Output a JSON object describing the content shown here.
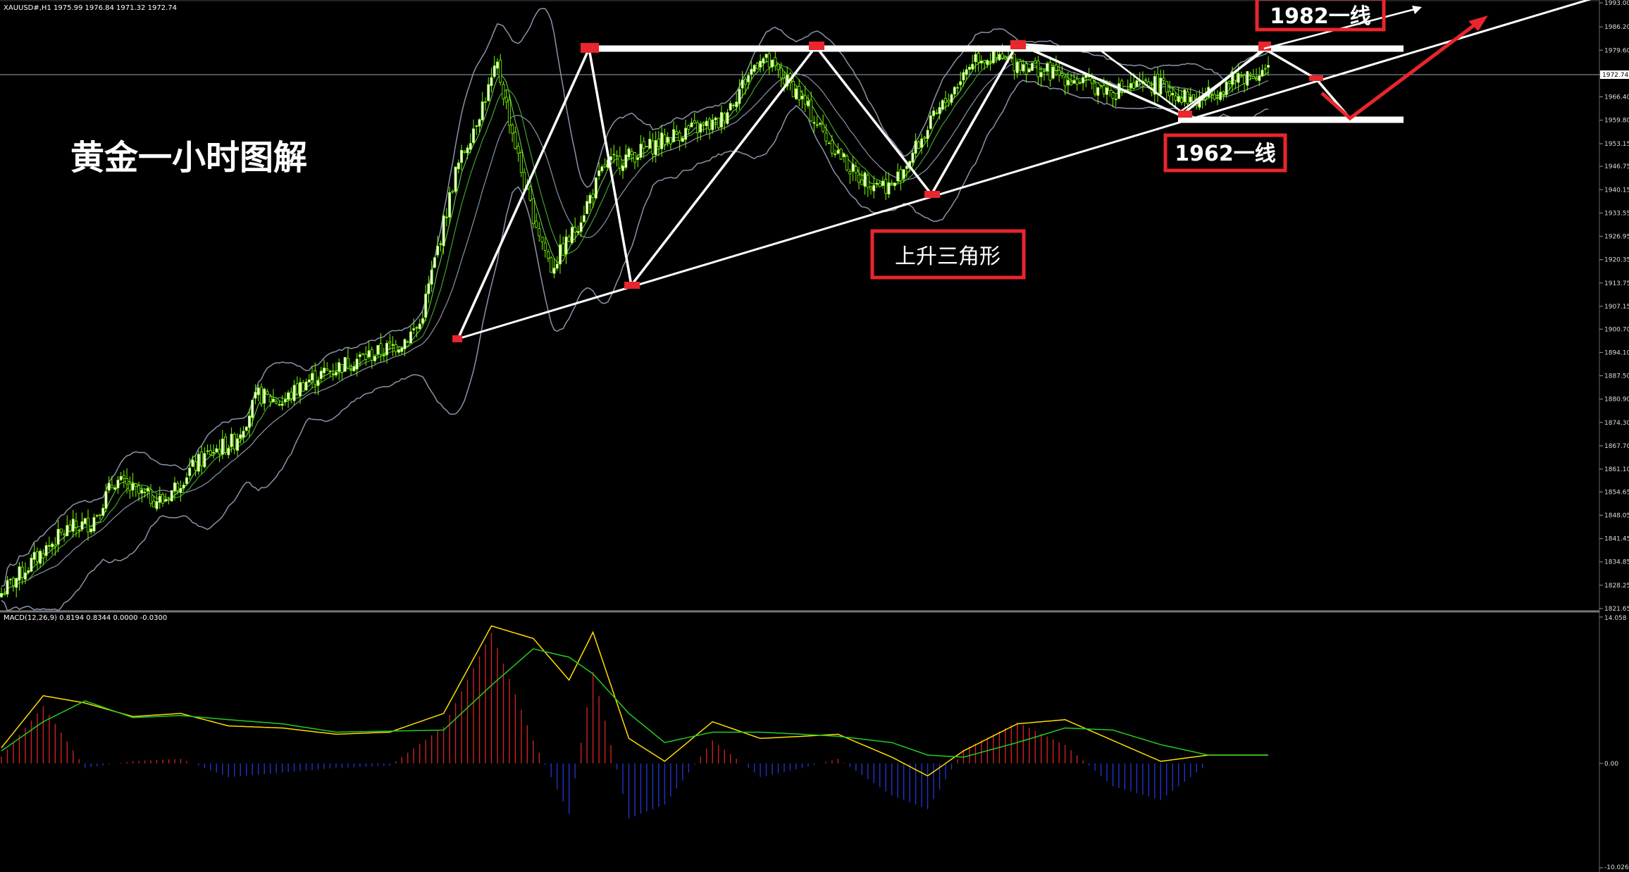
{
  "header": {
    "symbol_line": "XAUUSD#,H1  1975.99 1976.84 1971.32 1972.74"
  },
  "annotations": {
    "title": "黄金一小时图解",
    "triangle_label": "上升三角形",
    "resistance_label": "1982一线",
    "support_label": "1962一线"
  },
  "current_price": "1972.74",
  "colors": {
    "background": "#000000",
    "bull_candle": "#ffffff",
    "bear_candle": "#7cfc00",
    "bands": "#8894a8",
    "ma": "#5fbf3f",
    "annotation_box": "#e8262c",
    "trend_lines": "#ffffff",
    "macd_line": "#ffdd00",
    "signal_line": "#22cc22",
    "hist_pos": "#cc2222",
    "hist_neg": "#2233cc"
  },
  "chart_data": {
    "type": "candlestick",
    "symbol": "XAUUSD#",
    "timeframe": "H1",
    "price_axis": {
      "ylim": [
        1821.65,
        1993.0
      ],
      "ticks": [
        "1993.00",
        "1986.20",
        "1979.60",
        "1972.74",
        "1966.40",
        "1959.80",
        "1953.15",
        "1946.75",
        "1940.15",
        "1933.55",
        "1926.95",
        "1920.35",
        "1913.75",
        "1907.15",
        "1900.70",
        "1894.10",
        "1887.50",
        "1880.90",
        "1874.30",
        "1867.70",
        "1861.10",
        "1854.65",
        "1848.05",
        "1841.45",
        "1834.85",
        "1828.25",
        "1821.65"
      ]
    },
    "price_path_points": [
      [
        0,
        1826
      ],
      [
        14,
        1838
      ],
      [
        22,
        1844
      ],
      [
        30,
        1846
      ],
      [
        38,
        1858
      ],
      [
        46,
        1854
      ],
      [
        54,
        1852
      ],
      [
        62,
        1860
      ],
      [
        70,
        1866
      ],
      [
        78,
        1869
      ],
      [
        86,
        1882
      ],
      [
        94,
        1880
      ],
      [
        102,
        1886
      ],
      [
        110,
        1889
      ],
      [
        118,
        1892
      ],
      [
        126,
        1894
      ],
      [
        134,
        1897
      ],
      [
        140,
        1902
      ],
      [
        152,
        1945
      ],
      [
        166,
        1975
      ],
      [
        176,
        1938
      ],
      [
        184,
        1918
      ],
      [
        192,
        1929
      ],
      [
        202,
        1947
      ],
      [
        214,
        1951
      ],
      [
        226,
        1956
      ],
      [
        240,
        1959
      ],
      [
        254,
        1978
      ],
      [
        266,
        1968
      ],
      [
        276,
        1955
      ],
      [
        286,
        1944
      ],
      [
        298,
        1941
      ],
      [
        312,
        1960
      ],
      [
        326,
        1978
      ],
      [
        340,
        1976
      ],
      [
        356,
        1972
      ],
      [
        372,
        1968
      ],
      [
        386,
        1970
      ],
      [
        400,
        1965
      ],
      [
        414,
        1972
      ],
      [
        424,
        1974
      ]
    ],
    "macd": {
      "params": "MACD(12,26,9)",
      "values_label": "MACD(12,26,9) 0.8194 0.8344 0.0000 -0.0300",
      "ylim": [
        -10.026,
        14.058
      ],
      "ticks": [
        "14.058",
        "0.00",
        "-10.026"
      ],
      "macd_points": [
        [
          0,
          1.5
        ],
        [
          14,
          6.5
        ],
        [
          28,
          5.8
        ],
        [
          44,
          4.5
        ],
        [
          60,
          4.8
        ],
        [
          76,
          3.6
        ],
        [
          94,
          3.4
        ],
        [
          112,
          2.8
        ],
        [
          130,
          3.0
        ],
        [
          148,
          4.8
        ],
        [
          164,
          13.2
        ],
        [
          178,
          12.0
        ],
        [
          190,
          8.0
        ],
        [
          198,
          12.6
        ],
        [
          210,
          2.4
        ],
        [
          222,
          0.2
        ],
        [
          238,
          4.0
        ],
        [
          254,
          2.4
        ],
        [
          268,
          2.6
        ],
        [
          280,
          2.8
        ],
        [
          298,
          0.6
        ],
        [
          310,
          -1.2
        ],
        [
          322,
          1.2
        ],
        [
          340,
          3.8
        ],
        [
          356,
          4.2
        ],
        [
          372,
          2.2
        ],
        [
          388,
          0.2
        ],
        [
          404,
          0.8
        ],
        [
          424,
          0.8
        ]
      ],
      "signal_points": [
        [
          0,
          1.2
        ],
        [
          14,
          4.0
        ],
        [
          28,
          6.0
        ],
        [
          44,
          4.4
        ],
        [
          60,
          4.6
        ],
        [
          76,
          4.2
        ],
        [
          94,
          3.8
        ],
        [
          112,
          3.0
        ],
        [
          130,
          3.1
        ],
        [
          148,
          3.2
        ],
        [
          164,
          7.5
        ],
        [
          178,
          11.0
        ],
        [
          190,
          10.2
        ],
        [
          198,
          8.6
        ],
        [
          210,
          4.8
        ],
        [
          222,
          2.0
        ],
        [
          238,
          3.0
        ],
        [
          254,
          3.0
        ],
        [
          268,
          2.8
        ],
        [
          280,
          2.6
        ],
        [
          298,
          2.0
        ],
        [
          310,
          0.8
        ],
        [
          322,
          0.6
        ],
        [
          340,
          2.0
        ],
        [
          356,
          3.4
        ],
        [
          372,
          3.2
        ],
        [
          388,
          1.8
        ],
        [
          404,
          0.8
        ],
        [
          424,
          0.8
        ]
      ]
    }
  }
}
